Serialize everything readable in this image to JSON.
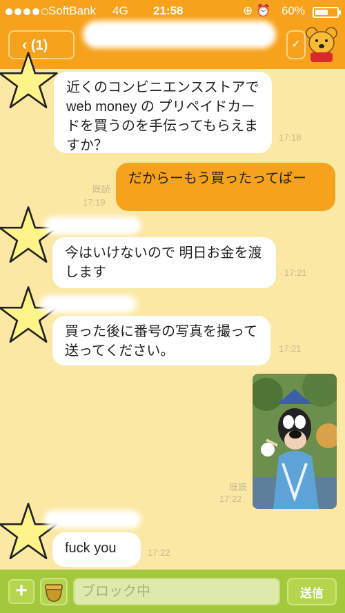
{
  "status_bar": {
    "signal_filled": 4,
    "carrier": "SoftBank",
    "network": "4G",
    "time": "21:58",
    "status_icons": "⊕ ⏰",
    "battery_label": "60%",
    "battery_level": 0.6
  },
  "header": {
    "back_chevron": "‹",
    "back_label": "(1)",
    "menu_chevron": "✓",
    "background_color": "#f6a21c"
  },
  "messages": [
    {
      "side": "left",
      "text_lines": [
        "近くのコンビニエンスストアでweb money の プリペイドカードを買うのを手伝ってもらえますか？"
      ],
      "time": "17:18"
    },
    {
      "side": "right",
      "text": "だからーもう買ったってばー",
      "read": "既読",
      "time": "17:19"
    },
    {
      "side": "left",
      "text": "今はいけないので 明日お金を渡します",
      "time": "17:21"
    },
    {
      "side": "left",
      "text": "買った後に番号の写真を撮って送ってください。",
      "time": "17:21"
    },
    {
      "side": "right",
      "type": "photo",
      "read": "既読",
      "time": "17:22"
    },
    {
      "side": "left",
      "text": "fuck you",
      "time": "17:22"
    }
  ],
  "input": {
    "plus_label": "+",
    "placeholder": "ブロック中",
    "send_label": "送信"
  },
  "colors": {
    "chat_background": "#fbe8a4",
    "bubble_right": "#f6a21c",
    "bottom_bar": "#a4c83b"
  }
}
